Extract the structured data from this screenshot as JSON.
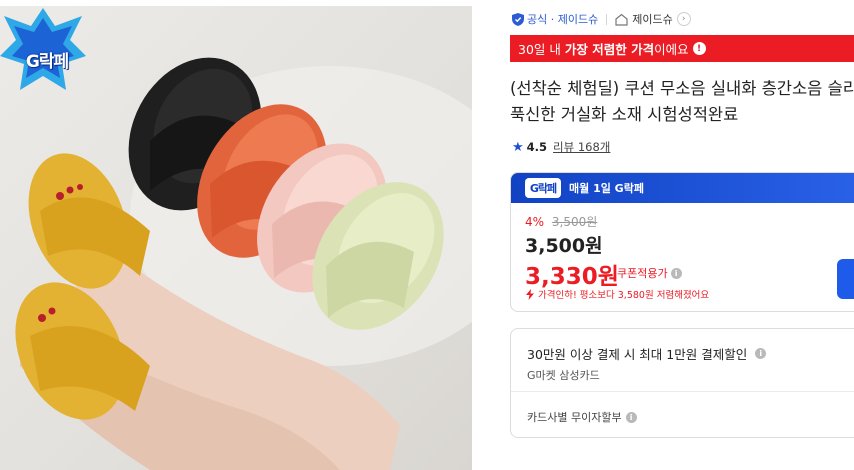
{
  "hero": {
    "badge_text": "G락페",
    "image_alt": "sandals-product-photo"
  },
  "seller": {
    "official_label": "공식 · 제이드슈",
    "store_label": "제이드슈",
    "chevron": "›"
  },
  "promo": {
    "prefix": "30일 내 ",
    "highlight": "가장 저렴한 가격",
    "suffix": "이에요",
    "info_icon": "!"
  },
  "product": {
    "title_line1": "(선착순 체험딜) 쿠션 무소음 실내화 층간소음 슬리",
    "title_line2": "푹신한 거실화 소재 시험성적완료"
  },
  "rating": {
    "star": "★",
    "score": "4.5",
    "review_text": "리뷰 168개"
  },
  "price": {
    "gdeal_logo": "G락페",
    "gdeal_text": "매월 1일 G락페",
    "discount_rate": "4%",
    "original_price": "3,500원",
    "sale_price": "3,500원",
    "coupon_price": "3,330원",
    "coupon_label": "쿠폰적용가",
    "coupon_info": "i",
    "price_down_text": "가격인하! 평소보다 3,580원 저렴해졌어요"
  },
  "benefit": {
    "main": "30만원 이상 결제 시 최대 1만원 결제할인",
    "main_info": "i",
    "sub": "G마켓 삼성카드",
    "installment": "카드사별 무이자할부",
    "installment_info": "i"
  },
  "colors": {
    "accent_red": "#ec1c24",
    "accent_blue": "#1f5bea",
    "official_blue": "#2d5bd1"
  }
}
